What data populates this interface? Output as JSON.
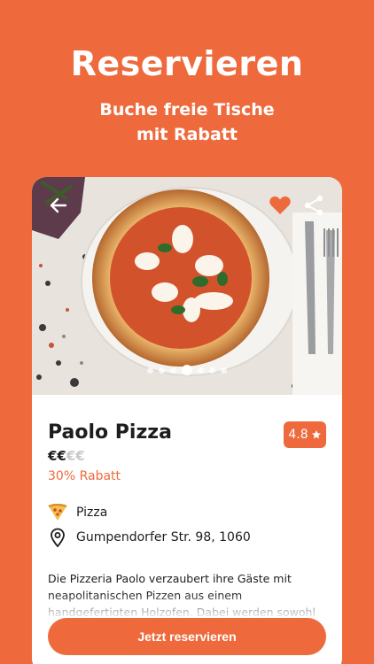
{
  "headline": "Reservieren",
  "subline_1": "Buche freie Tische",
  "subline_2": "mit Rabatt",
  "restaurant": {
    "name": "Paolo Pizza",
    "price_active": "€€",
    "price_inactive": "€€",
    "discount": "30% Rabatt",
    "rating": "4.8",
    "category": "Pizza",
    "address": "Gumpendorfer Str. 98, 1060",
    "description": "Die Pizzeria Paolo verzaubert ihre Gäste mit neapolitanischen Pizzen aus einem handgefertigten Holzofen. Dabei werden sowohl"
  },
  "gallery": {
    "dot_count": 7,
    "active_index": 3
  },
  "icons": {
    "back": "arrow-left-icon",
    "favorite": "heart-icon",
    "share": "share-icon",
    "category": "pizza-slice-icon",
    "address": "location-pin-icon",
    "rating": "star-icon"
  },
  "colors": {
    "accent": "#ee6a3d",
    "text": "#1d1d1d",
    "inactive_price": "#c9c9c9"
  },
  "cta": {
    "label": "Jetzt reservieren"
  }
}
